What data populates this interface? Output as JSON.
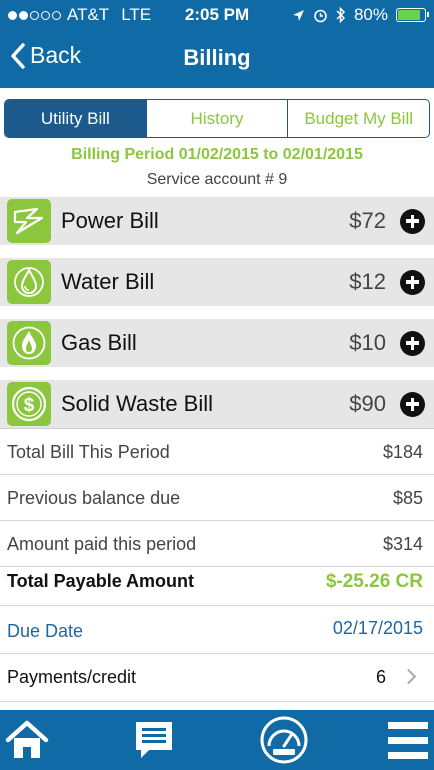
{
  "status_bar": {
    "carrier": "AT&T",
    "network": "LTE",
    "time": "2:05 PM",
    "battery": "80%",
    "battery_level": 0.8
  },
  "nav": {
    "back_label": "Back",
    "title": "Billing"
  },
  "tabs": [
    {
      "label": "Utility Bill",
      "active": true
    },
    {
      "label": "History",
      "active": false
    },
    {
      "label": "Budget My Bill",
      "active": false
    }
  ],
  "billing_period": "Billing Period 01/02/2015 to 02/01/2015",
  "service_account": "Service account # 9",
  "bills": [
    {
      "label": "Power Bill",
      "amount": "$72",
      "icon": "lightning-icon"
    },
    {
      "label": "Water Bill",
      "amount": "$12",
      "icon": "water-drop-icon"
    },
    {
      "label": "Gas Bill",
      "amount": "$10",
      "icon": "flame-icon"
    },
    {
      "label": "Solid Waste Bill",
      "amount": "$90",
      "icon": "dollar-coin-icon"
    }
  ],
  "summary": {
    "total_bill_label": "Total Bill This Period",
    "total_bill_value": "$184",
    "previous_balance_label": "Previous balance due",
    "previous_balance_value": "$85",
    "amount_paid_label": "Amount paid this period",
    "amount_paid_value": "$314",
    "total_payable_label": "Total Payable Amount",
    "total_payable_value": "$-25.26 CR",
    "due_date_label": "Due Date",
    "due_date_value": "02/17/2015",
    "payments_label": "Payments/credit",
    "payments_value": "6"
  },
  "tab_bar": [
    "home-icon",
    "message-icon",
    "gauge-meter-icon",
    "menu-icon"
  ],
  "colors": {
    "primary": "#0f6aa5",
    "accent": "#8cc63e",
    "segment": "#1d5a8c"
  }
}
